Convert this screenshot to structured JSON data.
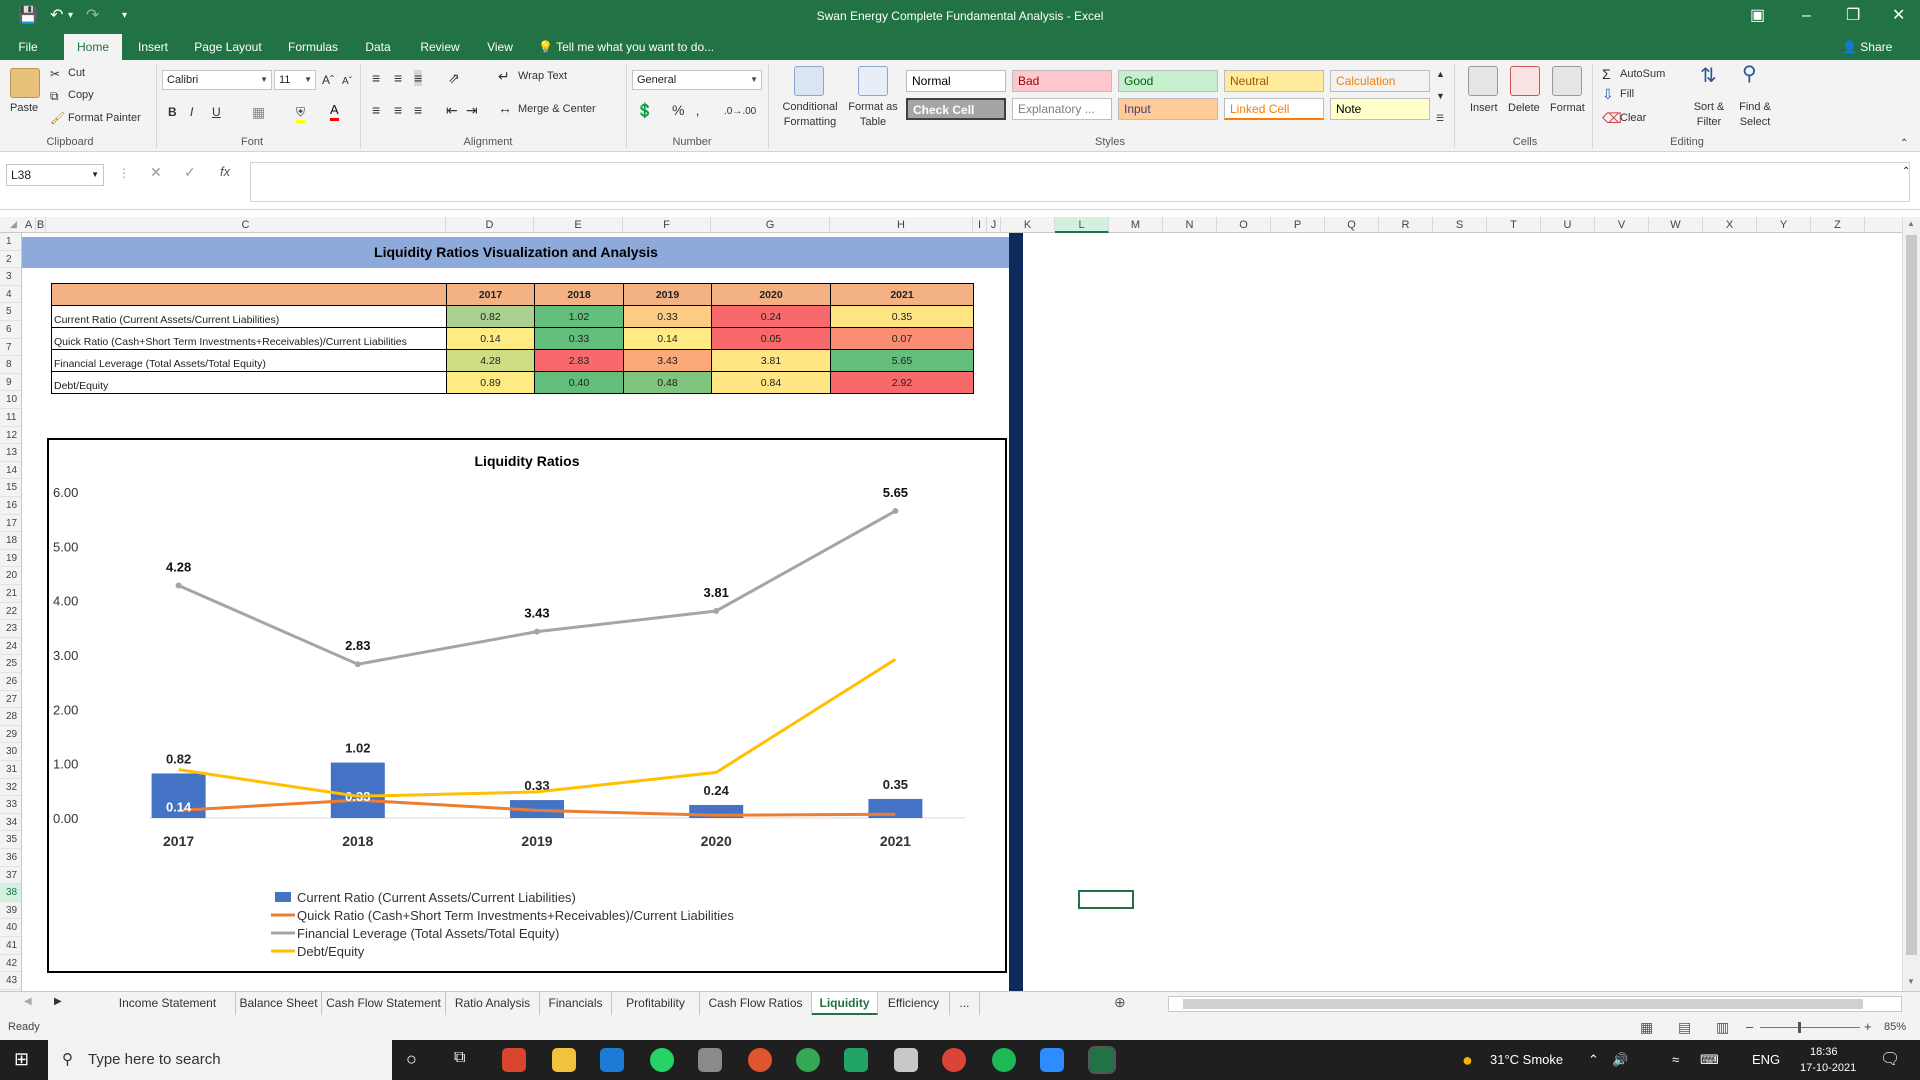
{
  "window": {
    "title": "Swan Energy Complete Fundamental Analysis - Excel"
  },
  "ribbon_tabs": [
    "File",
    "Home",
    "Insert",
    "Page Layout",
    "Formulas",
    "Data",
    "Review",
    "View"
  ],
  "tell_me": "Tell me what you want to do...",
  "share": "Share",
  "clipboard": {
    "paste": "Paste",
    "cut": "Cut",
    "copy": "Copy",
    "format_painter": "Format Painter",
    "group": "Clipboard"
  },
  "font": {
    "name": "Calibri",
    "size": "11",
    "group": "Font"
  },
  "alignment": {
    "wrap": "Wrap Text",
    "merge": "Merge & Center",
    "group": "Alignment"
  },
  "number": {
    "format": "General",
    "group": "Number"
  },
  "styles": {
    "conditional": "Conditional Formatting",
    "format_table": "Format as Table",
    "group": "Styles",
    "cells": [
      {
        "label": "Normal",
        "bg": "#ffffff",
        "color": "#000000"
      },
      {
        "label": "Bad",
        "bg": "#ffc7ce",
        "color": "#9c0006"
      },
      {
        "label": "Good",
        "bg": "#c6efce",
        "color": "#006100"
      },
      {
        "label": "Neutral",
        "bg": "#ffeb9c",
        "color": "#9c5700"
      },
      {
        "label": "Calculation",
        "bg": "#f2f2f2",
        "color": "#fa7d00"
      },
      {
        "label": "Check Cell",
        "bg": "#a5a5a5",
        "color": "#ffffff"
      },
      {
        "label": "Explanatory ...",
        "bg": "#ffffff",
        "color": "#7f7f7f"
      },
      {
        "label": "Input",
        "bg": "#ffcc99",
        "color": "#3f3f76"
      },
      {
        "label": "Linked Cell",
        "bg": "#ffffff",
        "color": "#fa7d00"
      },
      {
        "label": "Note",
        "bg": "#ffffcc",
        "color": "#000000"
      }
    ]
  },
  "cells_group": {
    "insert": "Insert",
    "delete": "Delete",
    "format": "Format",
    "group": "Cells"
  },
  "editing": {
    "autosum": "AutoSum",
    "fill": "Fill",
    "clear": "Clear",
    "sort": "Sort & Filter",
    "find": "Find & Select",
    "group": "Editing"
  },
  "formula_bar": {
    "name_box": "L38",
    "fx": "fx",
    "formula": ""
  },
  "columns": [
    "A",
    "B",
    "C",
    "D",
    "E",
    "F",
    "G",
    "H",
    "I",
    "J",
    "K",
    "L",
    "M",
    "N",
    "O",
    "P",
    "Q",
    "R",
    "S",
    "T",
    "U",
    "V",
    "W",
    "X",
    "Y",
    "Z"
  ],
  "selected_column": "L",
  "selected_row": "38",
  "sheet": {
    "banner": "Liquidity Ratios Visualization and Analysis",
    "table": {
      "years": [
        "2017",
        "2018",
        "2019",
        "2020",
        "2021"
      ],
      "rows": [
        {
          "label": "Current Ratio (Current Assets/Current Liabilities)",
          "values": [
            "0.82",
            "1.02",
            "0.33",
            "0.24",
            "0.35"
          ],
          "colors": [
            "#a9d08e",
            "#63be7b",
            "#fccc83",
            "#f8696b",
            "#fee583"
          ]
        },
        {
          "label": "Quick Ratio (Cash+Short Term Investments+Receivables)/Current Liabilities",
          "values": [
            "0.14",
            "0.33",
            "0.14",
            "0.05",
            "0.07"
          ],
          "colors": [
            "#ffeb84",
            "#63be7b",
            "#ffeb84",
            "#f8696b",
            "#f98e74"
          ]
        },
        {
          "label": "Financial Leverage (Total Assets/Total Equity)",
          "values": [
            "4.28",
            "2.83",
            "3.43",
            "3.81",
            "5.65"
          ],
          "colors": [
            "#cddd82",
            "#f8696b",
            "#fba977",
            "#ffe583",
            "#63be7b"
          ]
        },
        {
          "label": "Debt/Equity",
          "values": [
            "0.89",
            "0.40",
            "0.48",
            "0.84",
            "2.92"
          ],
          "colors": [
            "#ffeb84",
            "#63be7b",
            "#7fc57d",
            "#ffe583",
            "#f8696b"
          ]
        }
      ]
    }
  },
  "chart_data": {
    "type": "bar",
    "title": "Liquidity Ratios",
    "categories": [
      "2017",
      "2018",
      "2019",
      "2020",
      "2021"
    ],
    "ylim": [
      0,
      6
    ],
    "yticks": [
      "0.00",
      "1.00",
      "2.00",
      "3.00",
      "4.00",
      "5.00",
      "6.00"
    ],
    "series": [
      {
        "name": "Current Ratio (Current Assets/Current Liabilities)",
        "type": "bar",
        "color": "#4472c4",
        "values": [
          0.82,
          1.02,
          0.33,
          0.24,
          0.35
        ]
      },
      {
        "name": "Quick Ratio (Cash+Short Term Investments+Receivables)/Current Liabilities",
        "type": "line",
        "color": "#ed7d31",
        "values": [
          0.14,
          0.33,
          0.14,
          0.05,
          0.07
        ]
      },
      {
        "name": "Financial Leverage (Total Assets/Total Equity)",
        "type": "line",
        "color": "#a5a5a5",
        "values": [
          4.28,
          2.83,
          3.43,
          3.81,
          5.65
        ]
      },
      {
        "name": "Debt/Equity",
        "type": "line",
        "color": "#ffc000",
        "values": [
          0.89,
          0.4,
          0.48,
          0.84,
          2.92
        ]
      }
    ],
    "data_labels": {
      "bar": [
        "0.82",
        "1.02",
        "0.33",
        "0.24",
        "0.35"
      ],
      "quick": [
        "0.14",
        "0.33",
        "",
        "",
        ""
      ],
      "leverage": [
        "4.28",
        "2.83",
        "3.43",
        "3.81",
        "5.65"
      ]
    },
    "grid": false,
    "legend": "bottom"
  },
  "sheet_tabs": [
    "Income Statement",
    "Balance Sheet",
    "Cash Flow Statement",
    "Ratio Analysis",
    "Financials",
    "Profitability",
    "Cash Flow Ratios",
    "Liquidity",
    "Efficiency",
    "..."
  ],
  "active_sheet": "Liquidity",
  "status": {
    "ready": "Ready",
    "zoom": "85%"
  },
  "taskbar": {
    "search": "Type here to search",
    "weather": "31°C  Smoke",
    "lang": "ENG",
    "time": "18:36",
    "date": "17-10-2021"
  }
}
